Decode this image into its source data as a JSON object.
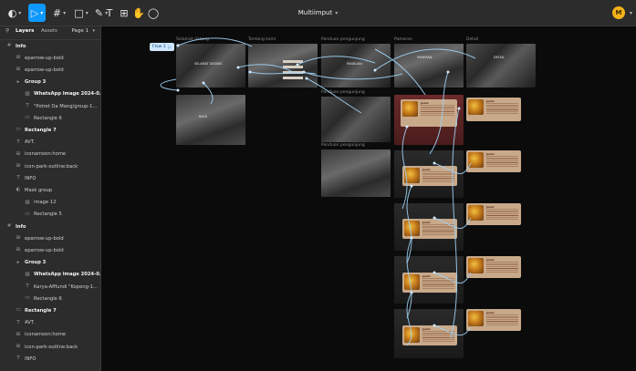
{
  "toolbar": {
    "file_title": "Multiimput",
    "avatar_initial": "M",
    "tools": [
      {
        "name": "main-menu-icon",
        "glyph": "◐"
      },
      {
        "name": "move-tool-icon",
        "glyph": "▷"
      },
      {
        "name": "frame-tool-icon",
        "glyph": "#"
      },
      {
        "name": "shape-tool-icon",
        "glyph": "□"
      },
      {
        "name": "pen-tool-icon",
        "glyph": "✎"
      },
      {
        "name": "text-tool-icon",
        "glyph": "T"
      },
      {
        "name": "resources-icon",
        "glyph": "⊞"
      },
      {
        "name": "hand-tool-icon",
        "glyph": "✋"
      },
      {
        "name": "comment-tool-icon",
        "glyph": "◯"
      }
    ]
  },
  "sidebar": {
    "tab_layers": "Layers",
    "tab_assets": "Assets",
    "page": "Page 1",
    "layers": [
      {
        "label": "Info",
        "indent": 0,
        "bold": true,
        "icon": "#"
      },
      {
        "label": "eparrow-up-bold",
        "indent": 1,
        "bold": false,
        "icon": "⊞"
      },
      {
        "label": "eparrow-up-bold",
        "indent": 1,
        "bold": false,
        "icon": "⊞"
      },
      {
        "label": "Group 3",
        "indent": 1,
        "bold": true,
        "icon": "▸"
      },
      {
        "label": "WhatsApp Image 2024-0...",
        "indent": 2,
        "bold": true,
        "icon": "▨"
      },
      {
        "label": "\"Potret Da Mang/group-1...",
        "indent": 2,
        "bold": false,
        "icon": "T"
      },
      {
        "label": "Rectangle 6",
        "indent": 2,
        "bold": false,
        "icon": "▭"
      },
      {
        "label": "Rectangle 7",
        "indent": 1,
        "bold": true,
        "icon": "▭"
      },
      {
        "label": "AVT.",
        "indent": 1,
        "bold": false,
        "icon": "T"
      },
      {
        "label": "iconamoon:home",
        "indent": 1,
        "bold": false,
        "icon": "⊞"
      },
      {
        "label": "icon-park-outline:back",
        "indent": 1,
        "bold": false,
        "icon": "⊞"
      },
      {
        "label": "INFO",
        "indent": 1,
        "bold": false,
        "icon": "T"
      },
      {
        "label": "Mask group",
        "indent": 1,
        "bold": false,
        "icon": "◐"
      },
      {
        "label": "image 12",
        "indent": 2,
        "bold": false,
        "icon": "▨"
      },
      {
        "label": "Rectangle 5",
        "indent": 2,
        "bold": false,
        "icon": "▭"
      },
      {
        "label": "Info",
        "indent": 0,
        "bold": true,
        "icon": "#"
      },
      {
        "label": "eparrow-up-bold",
        "indent": 1,
        "bold": false,
        "icon": "⊞"
      },
      {
        "label": "eparrow-up-bold",
        "indent": 1,
        "bold": false,
        "icon": "⊞"
      },
      {
        "label": "Group 3",
        "indent": 1,
        "bold": true,
        "icon": "▸"
      },
      {
        "label": "WhatsApp Image 2024-0...",
        "indent": 2,
        "bold": true,
        "icon": "▨"
      },
      {
        "label": "Karya-Afflundi \"Kopeng-1...",
        "indent": 2,
        "bold": false,
        "icon": "T"
      },
      {
        "label": "Rectangle 6",
        "indent": 2,
        "bold": false,
        "icon": "▭"
      },
      {
        "label": "Rectangle 7",
        "indent": 1,
        "bold": true,
        "icon": "▭"
      },
      {
        "label": "AVT.",
        "indent": 1,
        "bold": false,
        "icon": "T"
      },
      {
        "label": "iconamoon:home",
        "indent": 1,
        "bold": false,
        "icon": "⊞"
      },
      {
        "label": "icon-park-outline:back",
        "indent": 1,
        "bold": false,
        "icon": "⊞"
      },
      {
        "label": "INFO",
        "indent": 1,
        "bold": false,
        "icon": "T"
      }
    ]
  },
  "canvas": {
    "flow_label": "Flow 1",
    "frame_labels": [
      "Selamat datang",
      "Tentang kami",
      "Panduan pengunjung",
      "Pameran",
      "Detail",
      "Panduan pengunjung",
      "Panduan pengunjung"
    ],
    "frame_texts": [
      "SELAMAT DATANG",
      "PAMERAN",
      "DETAIL",
      "PANDUAN",
      "BACK"
    ],
    "card_title": "Judul"
  }
}
